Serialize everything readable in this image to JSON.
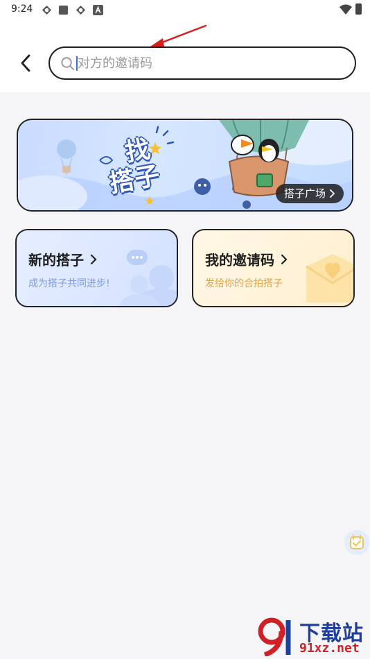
{
  "status_bar": {
    "time": "9:24"
  },
  "search": {
    "placeholder": "对方的邀请码",
    "value": ""
  },
  "banner": {
    "title_line1": "找",
    "title_line2": "搭子",
    "link_label": "搭子广场"
  },
  "cards": [
    {
      "title": "新的搭子",
      "subtitle": "成为搭子共同进步!"
    },
    {
      "title": "我的邀请码",
      "subtitle": "发给你的合拍搭子"
    }
  ],
  "watermark": {
    "text": "下载站",
    "url": "91xz.net"
  },
  "colors": {
    "accent_blue": "#3a6ee8",
    "annotation_arrow": "#d42020"
  }
}
